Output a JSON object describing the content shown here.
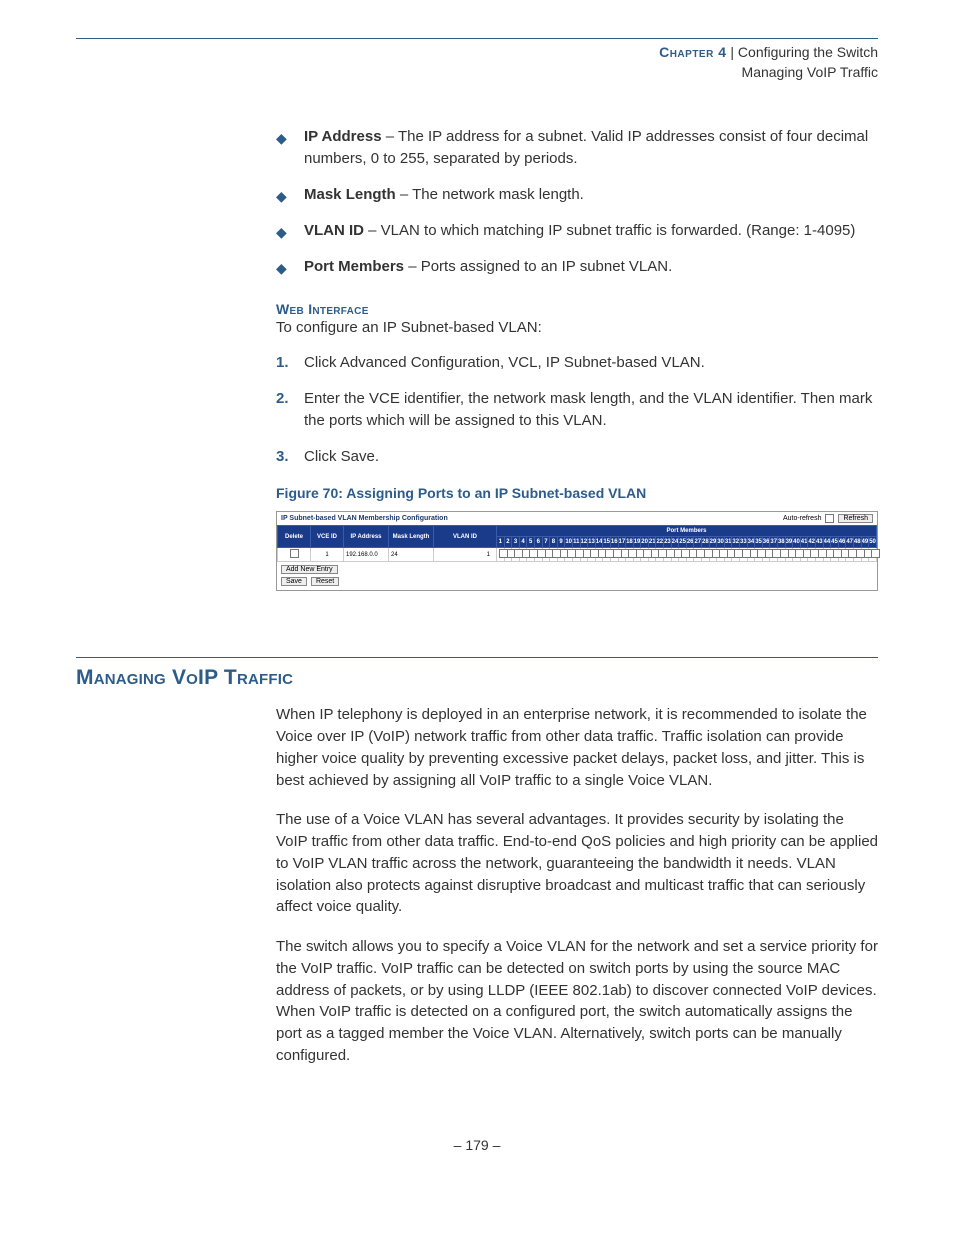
{
  "header": {
    "chapter_label": "Chapter 4",
    "separator": "  |  ",
    "chapter_title": "Configuring the Switch",
    "subtitle": "Managing VoIP Traffic"
  },
  "bullets": [
    {
      "term": "IP Address",
      "desc": " – The IP address for a subnet. Valid IP addresses consist of four decimal numbers, 0 to 255, separated by periods."
    },
    {
      "term": "Mask Length",
      "desc": " – The network mask length."
    },
    {
      "term": "VLAN ID",
      "desc": " – VLAN to which matching IP subnet traffic is forwarded. (Range: 1-4095)"
    },
    {
      "term": "Port Members",
      "desc": " – Ports assigned to an IP subnet VLAN."
    }
  ],
  "web_interface": {
    "heading": "Web Interface",
    "intro": "To configure an IP Subnet-based VLAN:",
    "steps": [
      "Click Advanced Configuration, VCL, IP Subnet-based VLAN.",
      "Enter the VCE identifier, the network mask length, and the VLAN identifier. Then mark the ports which will be assigned to this VLAN.",
      "Click Save."
    ]
  },
  "figure": {
    "caption": "Figure 70:  Assigning Ports to an IP Subnet-based VLAN",
    "title": "IP Subnet-based VLAN Membership Configuration",
    "autorefresh_label": "Auto-refresh",
    "refresh_btn": "Refresh",
    "port_members_header": "Port Members",
    "cols": {
      "delete": "Delete",
      "vce": "VCE ID",
      "ip": "IP Address",
      "mask": "Mask Length",
      "vlan": "VLAN ID"
    },
    "port_count": 50,
    "row": {
      "vce": "1",
      "ip": "192.168.0.0",
      "mask": "24",
      "vlan": "1"
    },
    "add_btn": "Add New Entry",
    "save_btn": "Save",
    "reset_btn": "Reset"
  },
  "section": {
    "title": "Managing VoIP Traffic",
    "paras": [
      "When IP telephony is deployed in an enterprise network, it is recommended to isolate the Voice over IP (VoIP) network traffic from other data traffic. Traffic isolation can provide higher voice quality by preventing excessive packet delays, packet loss, and jitter. This is best achieved by assigning all VoIP traffic to a single Voice VLAN.",
      "The use of a Voice VLAN has several advantages. It provides security by isolating the VoIP traffic from other data traffic. End-to-end QoS policies and high priority can be applied to VoIP VLAN traffic across the network, guaranteeing the bandwidth it needs. VLAN isolation also protects against disruptive broadcast and multicast traffic that can seriously affect voice quality.",
      "The switch allows you to specify a Voice VLAN for the network and set a service priority for the VoIP traffic. VoIP traffic can be detected on switch ports by using the source MAC address of packets, or by using LLDP (IEEE 802.1ab) to discover connected VoIP devices. When VoIP traffic is detected on a configured port, the switch automatically assigns the port as a tagged member the Voice VLAN. Alternatively, switch ports can be manually configured."
    ]
  },
  "page_number": "– 179 –"
}
